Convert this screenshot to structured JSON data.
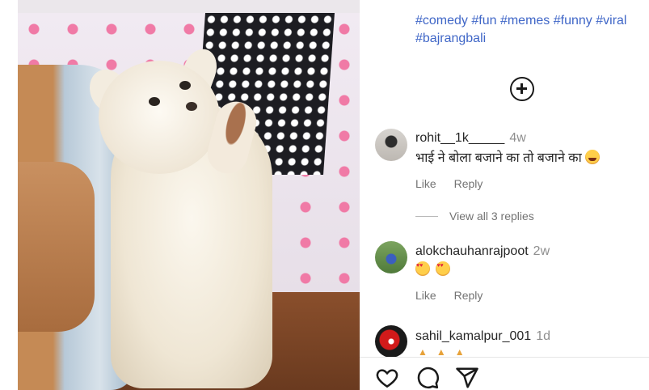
{
  "post": {
    "hashtags_line1": "#comedy #fun #memes #funny #viral",
    "hashtags_line2": "#bajrangbali"
  },
  "comments": [
    {
      "username": "rohit__1k_____",
      "age": "4w",
      "text": "भाई ने बोला बजाने का तो बजाने का",
      "emoji": "laughing-tears",
      "like_label": "Like",
      "reply_label": "Reply",
      "view_replies": "View all 3 replies"
    },
    {
      "username": "alokchauhanrajpoot",
      "age": "2w",
      "emoji": [
        "smiling-hearts",
        "smiling-hearts"
      ],
      "like_label": "Like",
      "reply_label": "Reply"
    },
    {
      "username": "sahil_kamalpur_001",
      "age": "1d"
    }
  ],
  "icons": {
    "add": "plus-circle-icon",
    "like": "heart-icon",
    "comment": "comment-bubble-icon",
    "share": "paper-plane-icon"
  },
  "colors": {
    "hashtag": "#3f66c7",
    "muted": "#8e8e8e",
    "text": "#262626"
  }
}
